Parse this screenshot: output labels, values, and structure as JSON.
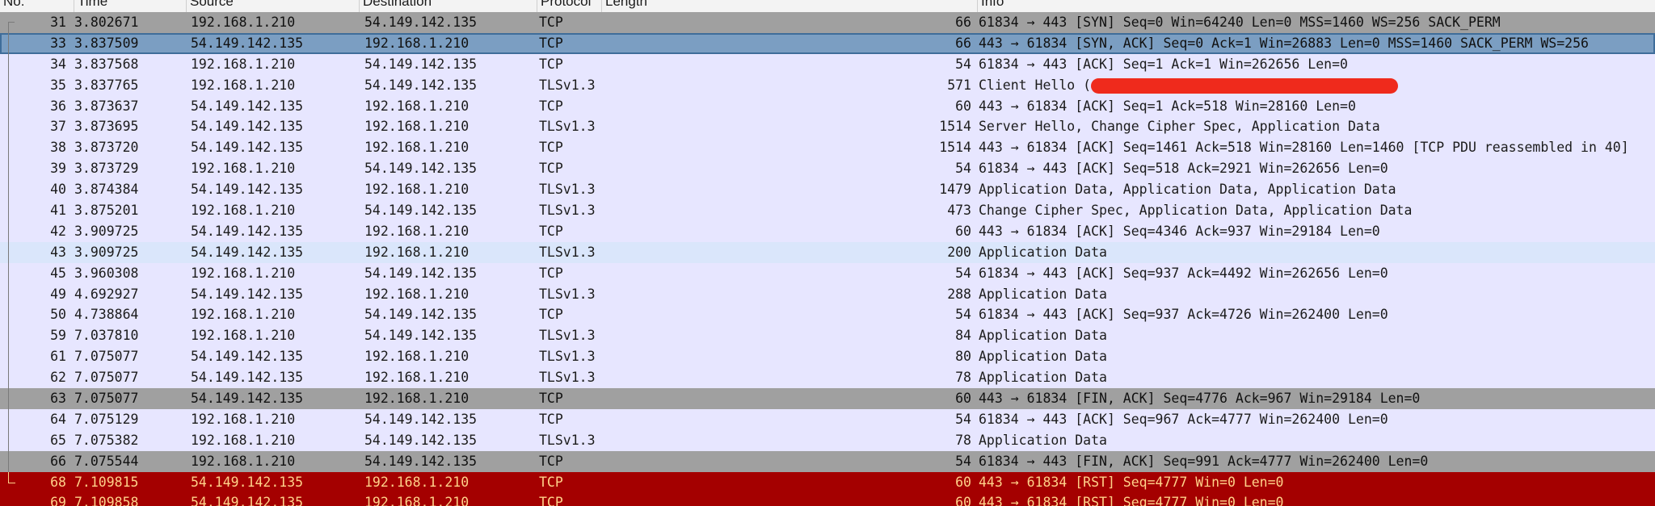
{
  "columns": {
    "no": "No.",
    "time": "Time",
    "source": "Source",
    "destination": "Destination",
    "protocol": "Protocol",
    "length": "Length",
    "info": "Info"
  },
  "colors": {
    "tcp": "#e7e6ff",
    "highlight_tls": "#dae6fb",
    "syn_fin": "#a0a0a0",
    "selected": "#7b9ec2",
    "rst": "#a40000",
    "rst_text": "#ffd28a",
    "redaction": "#ef2a1c"
  },
  "packets": [
    {
      "no": "31",
      "time": "3.802671",
      "src": "192.168.1.210",
      "dst": "54.149.142.135",
      "proto": "TCP",
      "len": "66",
      "info": "61834 → 443 [SYN] Seq=0 Win=64240 Len=0 MSS=1460 WS=256 SACK_PERM"
    },
    {
      "no": "33",
      "time": "3.837509",
      "src": "54.149.142.135",
      "dst": "192.168.1.210",
      "proto": "TCP",
      "len": "66",
      "info": "443 → 61834 [SYN, ACK] Seq=0 Ack=1 Win=26883 Len=0 MSS=1460 SACK_PERM WS=256"
    },
    {
      "no": "34",
      "time": "3.837568",
      "src": "192.168.1.210",
      "dst": "54.149.142.135",
      "proto": "TCP",
      "len": "54",
      "info": "61834 → 443 [ACK] Seq=1 Ack=1 Win=262656 Len=0"
    },
    {
      "no": "35",
      "time": "3.837765",
      "src": "192.168.1.210",
      "dst": "54.149.142.135",
      "proto": "TLSv1.3",
      "len": "571",
      "info": "Client Hello ("
    },
    {
      "no": "36",
      "time": "3.873637",
      "src": "54.149.142.135",
      "dst": "192.168.1.210",
      "proto": "TCP",
      "len": "60",
      "info": "443 → 61834 [ACK] Seq=1 Ack=518 Win=28160 Len=0"
    },
    {
      "no": "37",
      "time": "3.873695",
      "src": "54.149.142.135",
      "dst": "192.168.1.210",
      "proto": "TLSv1.3",
      "len": "1514",
      "info": "Server Hello, Change Cipher Spec, Application Data"
    },
    {
      "no": "38",
      "time": "3.873720",
      "src": "54.149.142.135",
      "dst": "192.168.1.210",
      "proto": "TCP",
      "len": "1514",
      "info": "443 → 61834 [ACK] Seq=1461 Ack=518 Win=28160 Len=1460 [TCP PDU reassembled in 40]"
    },
    {
      "no": "39",
      "time": "3.873729",
      "src": "192.168.1.210",
      "dst": "54.149.142.135",
      "proto": "TCP",
      "len": "54",
      "info": "61834 → 443 [ACK] Seq=518 Ack=2921 Win=262656 Len=0"
    },
    {
      "no": "40",
      "time": "3.874384",
      "src": "54.149.142.135",
      "dst": "192.168.1.210",
      "proto": "TLSv1.3",
      "len": "1479",
      "info": "Application Data, Application Data, Application Data"
    },
    {
      "no": "41",
      "time": "3.875201",
      "src": "192.168.1.210",
      "dst": "54.149.142.135",
      "proto": "TLSv1.3",
      "len": "473",
      "info": "Change Cipher Spec, Application Data, Application Data"
    },
    {
      "no": "42",
      "time": "3.909725",
      "src": "54.149.142.135",
      "dst": "192.168.1.210",
      "proto": "TCP",
      "len": "60",
      "info": "443 → 61834 [ACK] Seq=4346 Ack=937 Win=29184 Len=0"
    },
    {
      "no": "43",
      "time": "3.909725",
      "src": "54.149.142.135",
      "dst": "192.168.1.210",
      "proto": "TLSv1.3",
      "len": "200",
      "info": "Application Data"
    },
    {
      "no": "45",
      "time": "3.960308",
      "src": "192.168.1.210",
      "dst": "54.149.142.135",
      "proto": "TCP",
      "len": "54",
      "info": "61834 → 443 [ACK] Seq=937 Ack=4492 Win=262656 Len=0"
    },
    {
      "no": "49",
      "time": "4.692927",
      "src": "54.149.142.135",
      "dst": "192.168.1.210",
      "proto": "TLSv1.3",
      "len": "288",
      "info": "Application Data"
    },
    {
      "no": "50",
      "time": "4.738864",
      "src": "192.168.1.210",
      "dst": "54.149.142.135",
      "proto": "TCP",
      "len": "54",
      "info": "61834 → 443 [ACK] Seq=937 Ack=4726 Win=262400 Len=0"
    },
    {
      "no": "59",
      "time": "7.037810",
      "src": "192.168.1.210",
      "dst": "54.149.142.135",
      "proto": "TLSv1.3",
      "len": "84",
      "info": "Application Data"
    },
    {
      "no": "61",
      "time": "7.075077",
      "src": "54.149.142.135",
      "dst": "192.168.1.210",
      "proto": "TLSv1.3",
      "len": "80",
      "info": "Application Data"
    },
    {
      "no": "62",
      "time": "7.075077",
      "src": "54.149.142.135",
      "dst": "192.168.1.210",
      "proto": "TLSv1.3",
      "len": "78",
      "info": "Application Data"
    },
    {
      "no": "63",
      "time": "7.075077",
      "src": "54.149.142.135",
      "dst": "192.168.1.210",
      "proto": "TCP",
      "len": "60",
      "info": "443 → 61834 [FIN, ACK] Seq=4776 Ack=967 Win=29184 Len=0"
    },
    {
      "no": "64",
      "time": "7.075129",
      "src": "192.168.1.210",
      "dst": "54.149.142.135",
      "proto": "TCP",
      "len": "54",
      "info": "61834 → 443 [ACK] Seq=967 Ack=4777 Win=262400 Len=0"
    },
    {
      "no": "65",
      "time": "7.075382",
      "src": "192.168.1.210",
      "dst": "54.149.142.135",
      "proto": "TLSv1.3",
      "len": "78",
      "info": "Application Data"
    },
    {
      "no": "66",
      "time": "7.075544",
      "src": "192.168.1.210",
      "dst": "54.149.142.135",
      "proto": "TCP",
      "len": "54",
      "info": "61834 → 443 [FIN, ACK] Seq=991 Ack=4777 Win=262400 Len=0"
    },
    {
      "no": "68",
      "time": "7.109815",
      "src": "54.149.142.135",
      "dst": "192.168.1.210",
      "proto": "TCP",
      "len": "60",
      "info": "443 → 61834 [RST] Seq=4777 Win=0 Len=0"
    },
    {
      "no": "69",
      "time": "7.109858",
      "src": "54.149.142.135",
      "dst": "192.168.1.210",
      "proto": "TCP",
      "len": "60",
      "info": "443 → 61834 [RST] Seq=4777 Win=0 Len=0"
    }
  ]
}
